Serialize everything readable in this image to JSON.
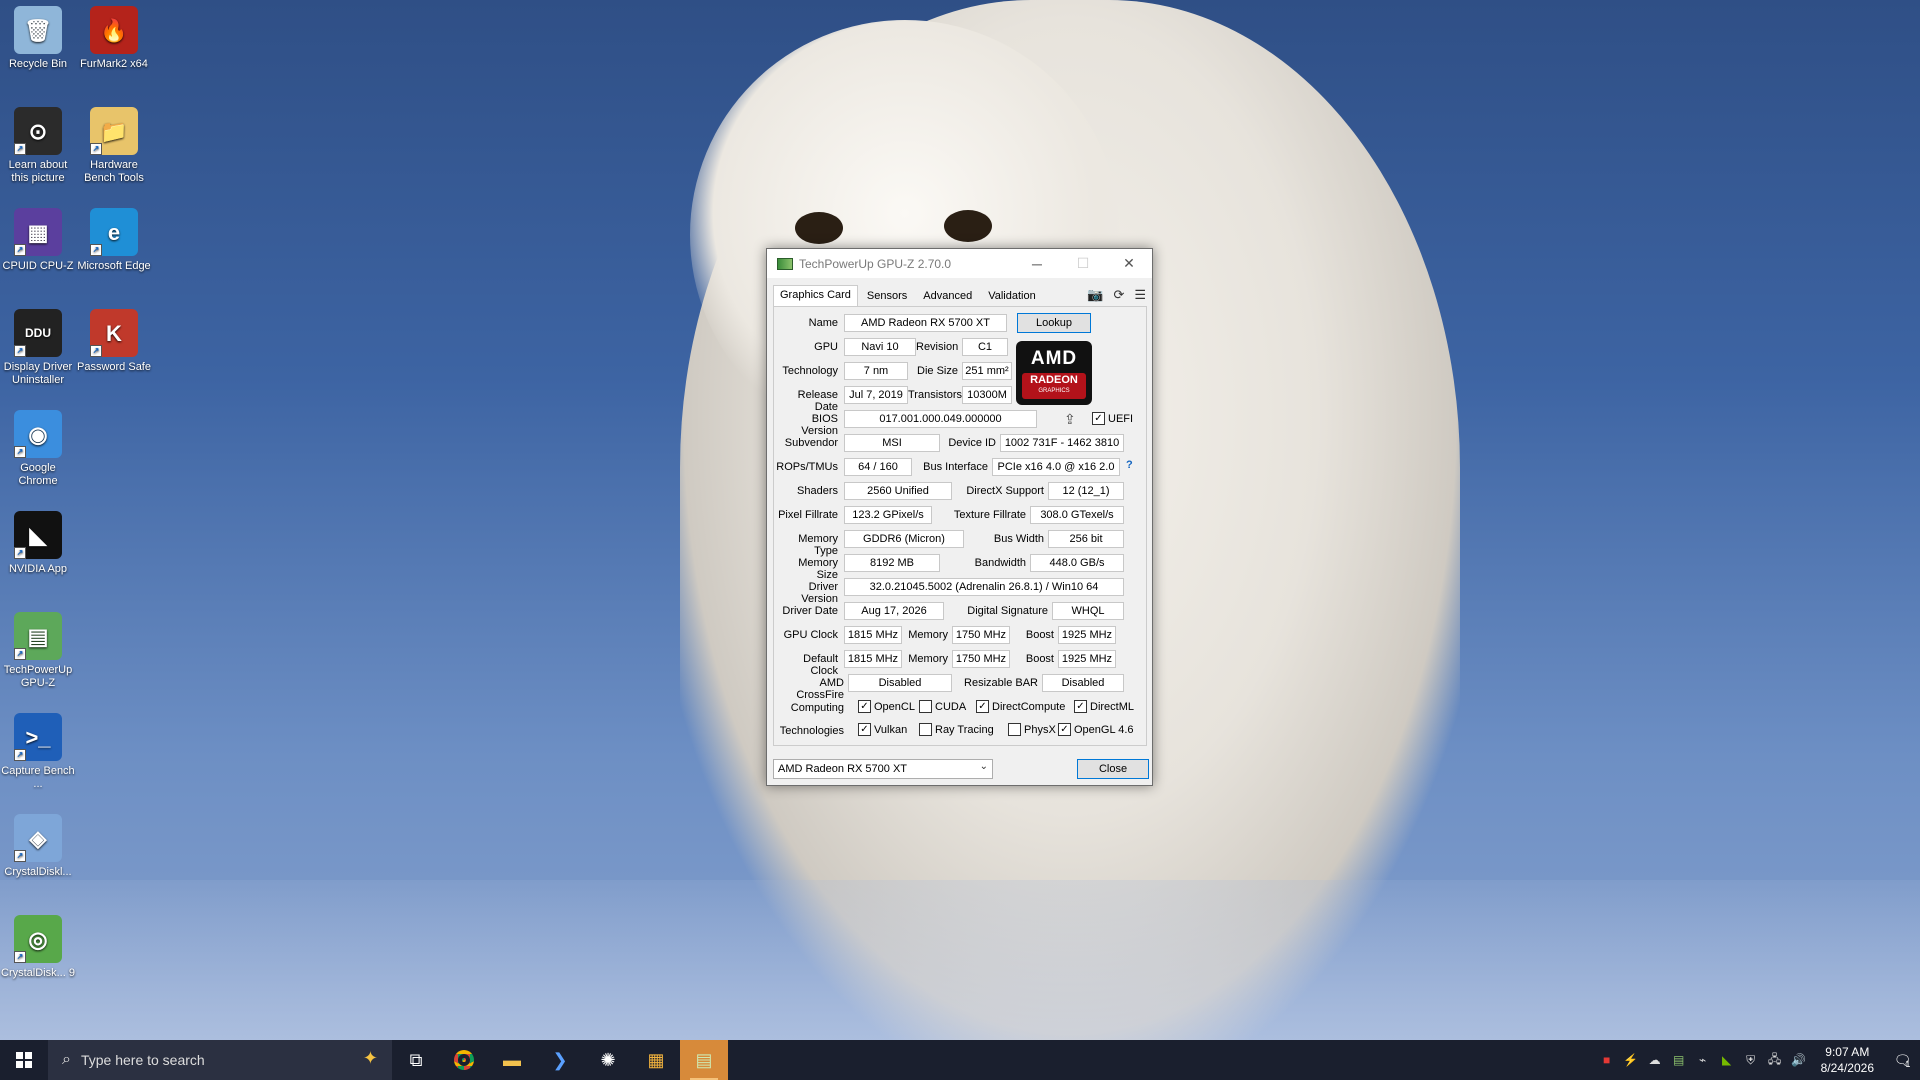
{
  "desktop": {
    "icons": [
      {
        "label": "Recycle Bin",
        "icon": "recycle-bin-icon",
        "color": "#8fb6d9",
        "glyph": "🗑"
      },
      {
        "label": "FurMark2 x64",
        "icon": "furmark-icon",
        "color": "#b4231b",
        "glyph": "🔥"
      },
      {
        "label": "Learn about this picture",
        "icon": "learn-picture-icon",
        "color": "#2b2b2b",
        "glyph": "⊙"
      },
      {
        "label": "Hardware Bench Tools",
        "icon": "folder-icon",
        "color": "#e8c46a",
        "glyph": "📁"
      },
      {
        "label": "CPUID CPU-Z",
        "icon": "cpuz-icon",
        "color": "#5b3f9e",
        "glyph": "▦"
      },
      {
        "label": "Microsoft Edge",
        "icon": "edge-icon",
        "color": "#1f8fd6",
        "glyph": "e"
      },
      {
        "label": "Display Driver Uninstaller",
        "icon": "ddu-icon",
        "color": "#222222",
        "glyph": "DDU"
      },
      {
        "label": "Password Safe",
        "icon": "password-safe-icon",
        "color": "#c0392b",
        "glyph": "K"
      },
      {
        "label": "Google Chrome",
        "icon": "chrome-icon",
        "color": "#3b8ede",
        "glyph": "◉"
      },
      {
        "label": "NVIDIA App",
        "icon": "nvidia-icon",
        "color": "#111111",
        "glyph": "◣"
      },
      {
        "label": "TechPowerUp GPU-Z",
        "icon": "gpuz-icon",
        "color": "#5da85a",
        "glyph": "▤"
      },
      {
        "label": "Capture Bench ...",
        "icon": "powershell-icon",
        "color": "#1f5fb8",
        "glyph": ">_"
      },
      {
        "label": "CrystalDiskl...",
        "icon": "crystaldisk-icon",
        "color": "#7ea6d8",
        "glyph": "◈"
      },
      {
        "label": "CrystalDisk... 9",
        "icon": "crystaldisk9-icon",
        "color": "#58a84a",
        "glyph": "◎"
      }
    ]
  },
  "window": {
    "title": "TechPowerUp GPU-Z 2.70.0",
    "tabs": [
      "Graphics Card",
      "Sensors",
      "Advanced",
      "Validation"
    ],
    "lookup": "Lookup",
    "close": "Close",
    "selected_gpu": "AMD Radeon RX 5700 XT",
    "logo": {
      "brand": "AMD",
      "line1": "RADEON",
      "line2": "GRAPHICS"
    },
    "labels": {
      "name": "Name",
      "gpu": "GPU",
      "revision": "Revision",
      "technology": "Technology",
      "die_size": "Die Size",
      "release_date": "Release Date",
      "transistors": "Transistors",
      "bios": "BIOS Version",
      "uefi": "UEFI",
      "subvendor": "Subvendor",
      "device_id": "Device ID",
      "rops": "ROPs/TMUs",
      "bus_interface": "Bus Interface",
      "shaders": "Shaders",
      "directx": "DirectX Support",
      "pixel": "Pixel Fillrate",
      "texture": "Texture Fillrate",
      "mem_type": "Memory Type",
      "bus_width": "Bus Width",
      "mem_size": "Memory Size",
      "bandwidth": "Bandwidth",
      "driver_version": "Driver Version",
      "driver_date": "Driver Date",
      "dig_sig": "Digital Signature",
      "gpu_clock": "GPU Clock",
      "memory": "Memory",
      "boost": "Boost",
      "default_clock": "Default Clock",
      "crossfire": "AMD CrossFire",
      "rebar": "Resizable BAR",
      "computing": "Computing",
      "technologies": "Technologies"
    },
    "values": {
      "name": "AMD Radeon RX 5700 XT",
      "gpu": "Navi 10",
      "revision": "C1",
      "technology": "7 nm",
      "die_size": "251 mm²",
      "release_date": "Jul 7, 2019",
      "transistors": "10300M",
      "bios": "017.001.000.049.000000",
      "subvendor": "MSI",
      "device_id": "1002 731F - 1462 3810",
      "rops": "64 / 160",
      "bus_interface": "PCIe x16 4.0 @ x16 2.0",
      "shaders": "2560 Unified",
      "directx": "12 (12_1)",
      "pixel": "123.2 GPixel/s",
      "texture": "308.0 GTexel/s",
      "mem_type": "GDDR6 (Micron)",
      "bus_width": "256 bit",
      "mem_size": "8192 MB",
      "bandwidth": "448.0 GB/s",
      "driver_version": "32.0.21045.5002 (Adrenalin 26.8.1) / Win10 64",
      "driver_date": "Aug 17, 2026",
      "dig_sig": "WHQL",
      "gpu_clock": "1815 MHz",
      "gpu_mem": "1750 MHz",
      "gpu_boost": "1925 MHz",
      "def_clock": "1815 MHz",
      "def_mem": "1750 MHz",
      "def_boost": "1925 MHz",
      "crossfire": "Disabled",
      "rebar": "Disabled"
    },
    "computing": [
      {
        "label": "OpenCL",
        "checked": true
      },
      {
        "label": "CUDA",
        "checked": false
      },
      {
        "label": "DirectCompute",
        "checked": true
      },
      {
        "label": "DirectML",
        "checked": true
      }
    ],
    "technologies": [
      {
        "label": "Vulkan",
        "checked": true
      },
      {
        "label": "Ray Tracing",
        "checked": false
      },
      {
        "label": "PhysX",
        "checked": false
      },
      {
        "label": "OpenGL 4.6",
        "checked": true
      }
    ]
  },
  "taskbar": {
    "search_placeholder": "Type here to search",
    "time": "9:07 AM",
    "date": "8/24/2026",
    "notification_count": "1"
  }
}
